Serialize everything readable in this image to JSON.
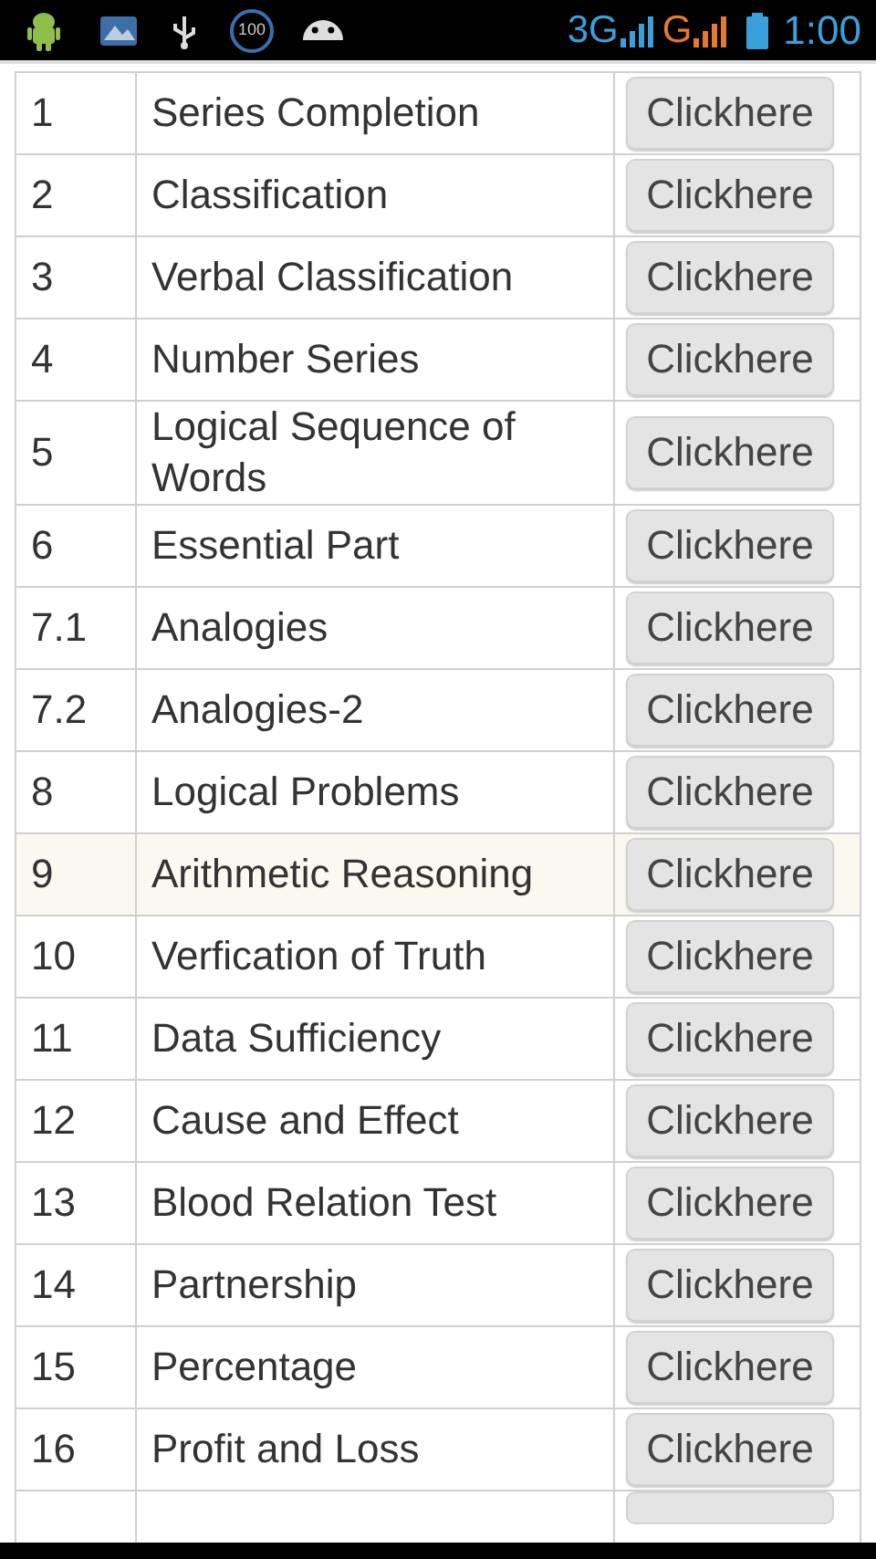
{
  "status_bar": {
    "battery_badge": "100",
    "network_1": "3G",
    "network_2": "G",
    "time": "1:00"
  },
  "table": {
    "rows": [
      {
        "number": "1",
        "title": "Series Completion",
        "button": "Clickhere",
        "selected": false
      },
      {
        "number": "2",
        "title": "Classification",
        "button": "Clickhere",
        "selected": false
      },
      {
        "number": "3",
        "title": "Verbal Classification",
        "button": "Clickhere",
        "selected": false
      },
      {
        "number": "4",
        "title": "Number Series",
        "button": "Clickhere",
        "selected": false
      },
      {
        "number": "5",
        "title": "Logical Sequence of Words",
        "button": "Clickhere",
        "selected": false
      },
      {
        "number": "6",
        "title": "Essential Part",
        "button": "Clickhere",
        "selected": false
      },
      {
        "number": "7.1",
        "title": "Analogies",
        "button": "Clickhere",
        "selected": false
      },
      {
        "number": "7.2",
        "title": "Analogies-2",
        "button": "Clickhere",
        "selected": false
      },
      {
        "number": "8",
        "title": "Logical Problems",
        "button": "Clickhere",
        "selected": false
      },
      {
        "number": "9",
        "title": "Arithmetic Reasoning",
        "button": "Clickhere",
        "selected": true
      },
      {
        "number": "10",
        "title": "Verfication of Truth",
        "button": "Clickhere",
        "selected": false
      },
      {
        "number": "11",
        "title": "Data Sufficiency",
        "button": "Clickhere",
        "selected": false
      },
      {
        "number": "12",
        "title": "Cause and Effect",
        "button": "Clickhere",
        "selected": false
      },
      {
        "number": "13",
        "title": "Blood Relation Test",
        "button": "Clickhere",
        "selected": false
      },
      {
        "number": "14",
        "title": "Partnership",
        "button": "Clickhere",
        "selected": false
      },
      {
        "number": "15",
        "title": "Percentage",
        "button": "Clickhere",
        "selected": false
      },
      {
        "number": "16",
        "title": "Profit and Loss",
        "button": "Clickhere",
        "selected": false
      }
    ]
  }
}
